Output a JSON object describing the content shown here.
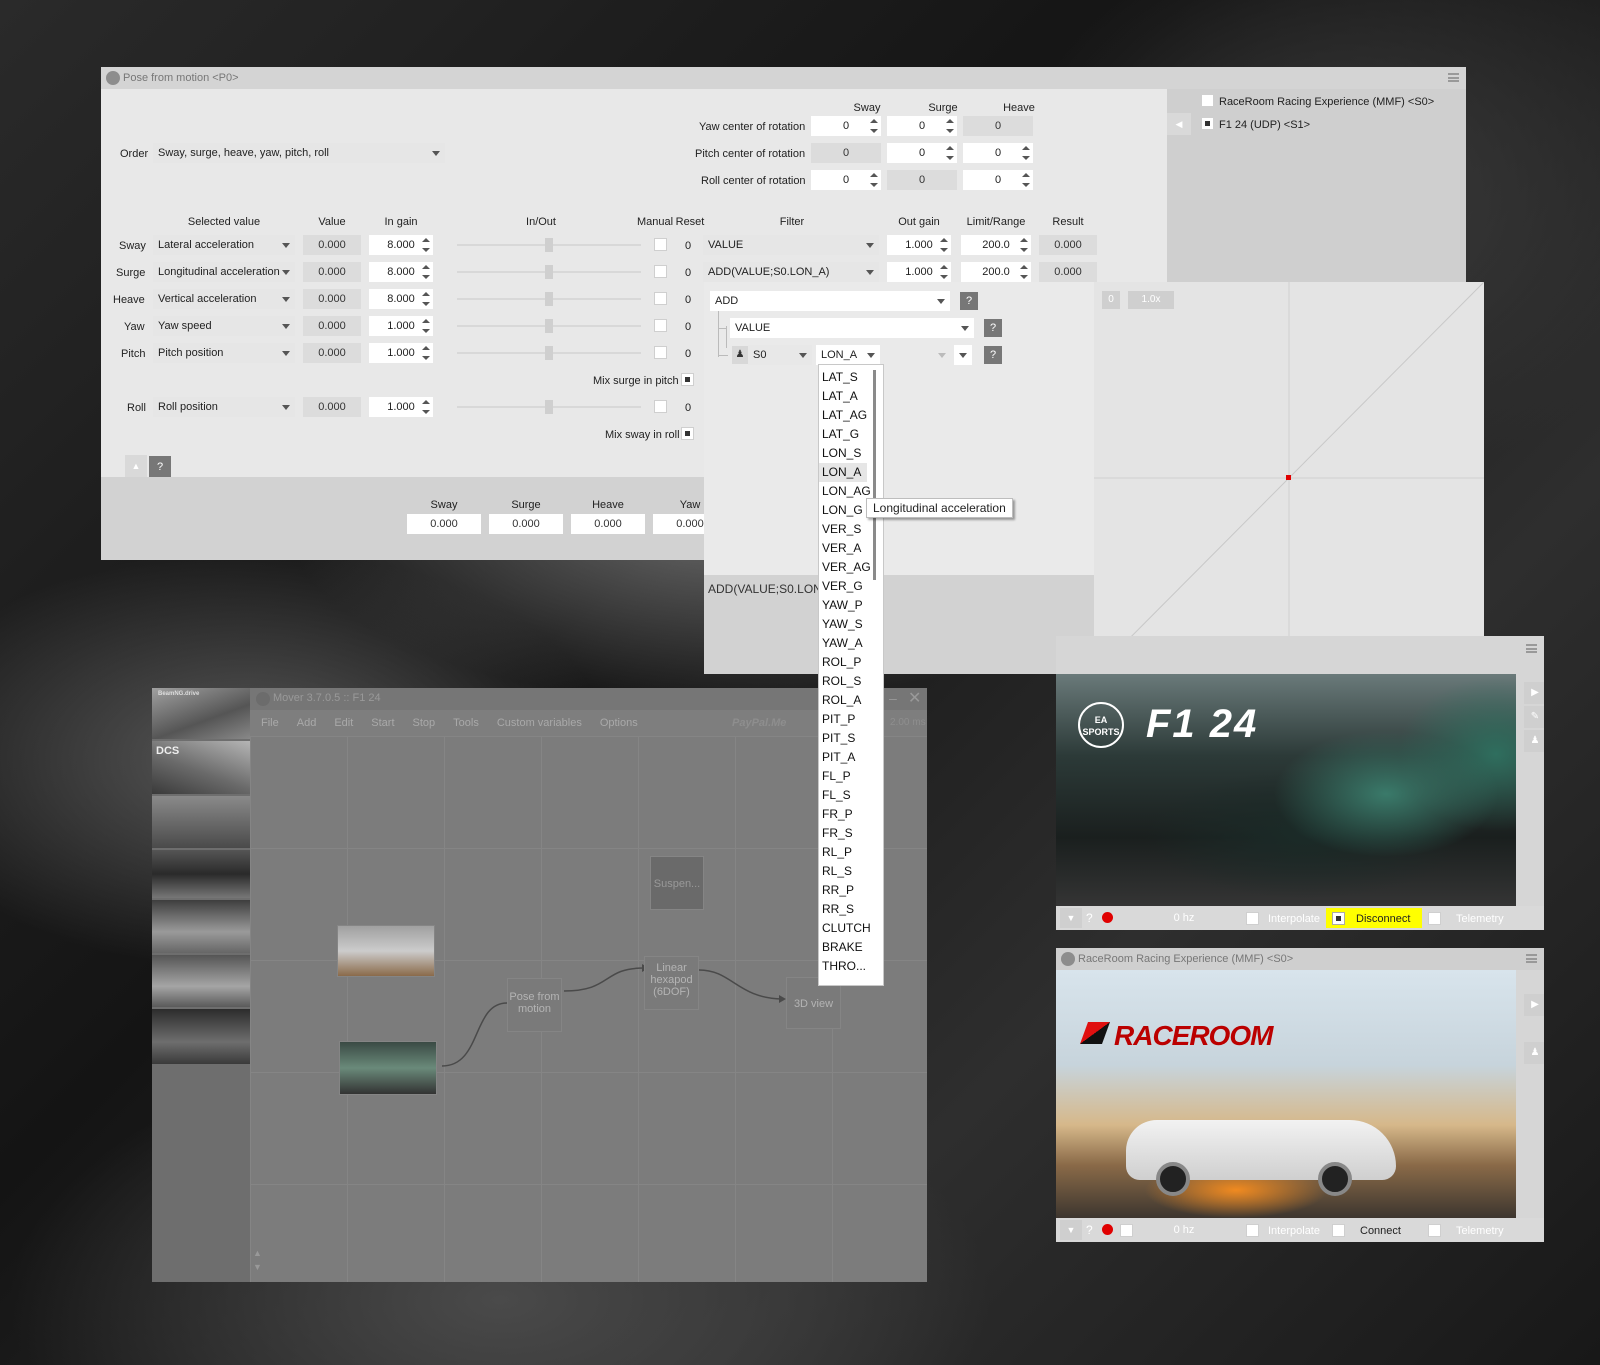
{
  "pose_window": {
    "title": "Pose from motion <P0>",
    "order_label": "Order",
    "order_value": "Sway, surge, heave, yaw, pitch, roll",
    "center_headers": [
      "Sway",
      "Surge",
      "Heave"
    ],
    "centers": [
      {
        "label": "Yaw center of rotation",
        "values": [
          "0",
          "0",
          "0"
        ]
      },
      {
        "label": "Pitch center of rotation",
        "values": [
          "0",
          "0",
          "0"
        ]
      },
      {
        "label": "Roll center of rotation",
        "values": [
          "0",
          "0",
          "0"
        ]
      }
    ],
    "columns": {
      "selected_value": "Selected value",
      "value": "Value",
      "in_gain": "In gain",
      "in_out": "In/Out",
      "manual": "Manual",
      "reset": "Reset",
      "filter": "Filter",
      "out_gain": "Out gain",
      "limit_range": "Limit/Range",
      "result": "Result"
    },
    "rows": [
      {
        "label": "Sway",
        "selected": "Lateral acceleration",
        "value": "0.000",
        "in_gain": "8.000",
        "reset": "0",
        "filter": "VALUE",
        "out_gain": "1.000",
        "limit": "200.0",
        "result": "0.000"
      },
      {
        "label": "Surge",
        "selected": "Longitudinal acceleration",
        "value": "0.000",
        "in_gain": "8.000",
        "reset": "0",
        "filter": "ADD(VALUE;S0.LON_A)",
        "out_gain": "1.000",
        "limit": "200.0",
        "result": "0.000"
      },
      {
        "label": "Heave",
        "selected": "Vertical acceleration",
        "value": "0.000",
        "in_gain": "8.000",
        "reset": "0"
      },
      {
        "label": "Yaw",
        "selected": "Yaw speed",
        "value": "0.000",
        "in_gain": "1.000",
        "reset": "0"
      },
      {
        "label": "Pitch",
        "selected": "Pitch position",
        "value": "0.000",
        "in_gain": "1.000",
        "reset": "0"
      },
      {
        "label": "Roll",
        "selected": "Roll position",
        "value": "0.000",
        "in_gain": "1.000",
        "reset": "0"
      }
    ],
    "mix_surge_label": "Mix surge in pitch",
    "mix_sway_label": "Mix sway in roll",
    "help_label": "?",
    "output_headers": [
      "Sway",
      "Surge",
      "Heave",
      "Yaw"
    ],
    "output_values": [
      "0.000",
      "0.000",
      "0.000",
      "0.000"
    ]
  },
  "sources_panel": {
    "items": [
      {
        "label": "RaceRoom Racing Experience (MMF) <S0>",
        "checked": false
      },
      {
        "label": "F1 24 (UDP) <S1>",
        "checked": true
      }
    ]
  },
  "filter_editor": {
    "op_value": "ADD",
    "value_label": "VALUE",
    "source_value": "S0",
    "channel_value": "LON_A",
    "help_label": "?",
    "zero_label": "0",
    "zoom_label": "1.0x",
    "expression": "ADD(VALUE;S0.LON_A)",
    "tooltip": "Longitudinal acceleration",
    "selected_option": "LON_A",
    "options": [
      "LAT_S",
      "LAT_A",
      "LAT_AG",
      "LAT_G",
      "LON_S",
      "LON_A",
      "LON_AG",
      "LON_G",
      "VER_S",
      "VER_A",
      "VER_AG",
      "VER_G",
      "YAW_P",
      "YAW_S",
      "YAW_A",
      "ROL_P",
      "ROL_S",
      "ROL_A",
      "PIT_P",
      "PIT_S",
      "PIT_A",
      "FL_P",
      "FL_S",
      "FR_P",
      "FR_S",
      "RL_P",
      "RL_S",
      "RR_P",
      "RR_S",
      "CLUTCH",
      "BRAKE",
      "THRO..."
    ]
  },
  "mover_window": {
    "title": "Mover 3.7.0.5 :: F1 24",
    "menu": [
      "File",
      "Add",
      "Edit",
      "Start",
      "Stop",
      "Tools",
      "Custom variables",
      "Options"
    ],
    "paypal": "PayPal.Me",
    "timing": "2.00 ms",
    "side_top_label": "BeamNG.drive",
    "side_dcs": "DCS",
    "nodes": {
      "suspension": "Suspen...",
      "pose": "Pose from motion",
      "hexapod": "Linear hexapod (6DOF)",
      "view3d": "3D view"
    }
  },
  "f1_window": {
    "logo_ea": "EA SPORTS",
    "logo_f1": "F1 24",
    "help_label": "?",
    "hz": "0 hz",
    "interpolate": "Interpolate",
    "connect_label": "Disconnect",
    "telemetry": "Telemetry"
  },
  "rr_window": {
    "title": "RaceRoom Racing Experience (MMF) <S0>",
    "logo": "RACEROOM",
    "help_label": "?",
    "hz": "0 hz",
    "interpolate": "Interpolate",
    "connect_label": "Connect",
    "telemetry": "Telemetry"
  },
  "colors": {
    "accent_yellow": "#ffff00",
    "record_red": "#e00000",
    "graph_point": "#e00000"
  }
}
